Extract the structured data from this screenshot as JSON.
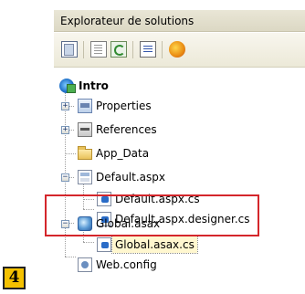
{
  "panel": {
    "title": "Explorateur de solutions"
  },
  "toolbar": {
    "buttons": [
      {
        "icon": "properties-icon"
      },
      {
        "icon": "show-all-files-icon"
      },
      {
        "icon": "refresh-icon"
      },
      {
        "icon": "view-code-icon"
      },
      {
        "icon": "view-designer-icon"
      }
    ]
  },
  "tree": {
    "project": "Intro",
    "items": {
      "properties": "Properties",
      "references": "References",
      "app_data": "App_Data",
      "default_aspx": "Default.aspx",
      "default_aspx_cs": "Default.aspx.cs",
      "default_aspx_designer_cs": "Default.aspx.designer.cs",
      "global_asax": "Global.asax",
      "global_asax_cs": "Global.asax.cs",
      "web_config": "Web.config"
    },
    "expanders": {
      "plus": "+",
      "minus": "−"
    }
  },
  "badge": {
    "label": "4"
  },
  "colors": {
    "highlight": "#d4262b",
    "badge": "#f4c100"
  }
}
